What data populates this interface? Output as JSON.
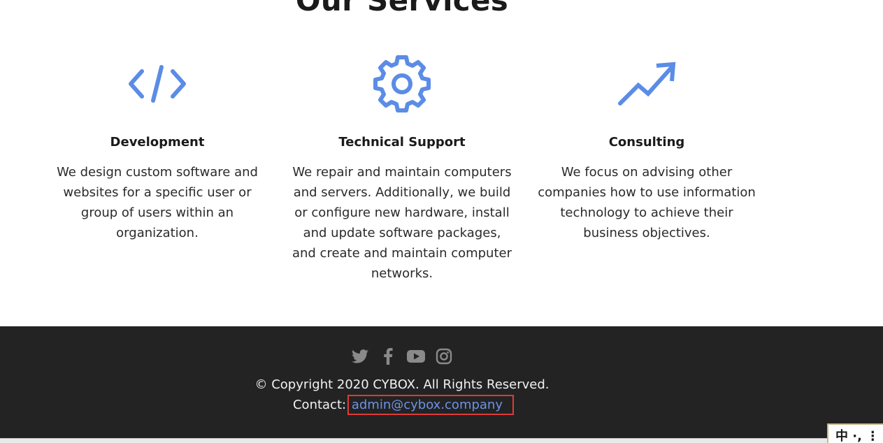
{
  "section": {
    "title": "Our Services"
  },
  "services": [
    {
      "icon": "code-icon",
      "title": "Development",
      "description": "We design custom software and websites for a specific user or group of users within an organization."
    },
    {
      "icon": "gear-icon",
      "title": "Technical Support",
      "description": "We repair and maintain computers and servers. Additionally, we build or configure new hardware, install and update software packages, and create and maintain computer networks."
    },
    {
      "icon": "trending-up-icon",
      "title": "Consulting",
      "description": "We focus on advising other companies how to use information technology to achieve their business objectives."
    }
  ],
  "footer": {
    "social": [
      "twitter-icon",
      "facebook-icon",
      "youtube-icon",
      "instagram-icon"
    ],
    "copyright": "© Copyright 2020 CYBOX. All Rights Reserved.",
    "contact_label": "Contact:",
    "contact_email": "admin@cybox.company"
  },
  "ime": {
    "label": "中 ·, ⋮"
  },
  "colors": {
    "accent": "#5b8ce6",
    "footer_bg": "#232323",
    "link": "#6b93e8",
    "highlight": "#e03a3a"
  }
}
